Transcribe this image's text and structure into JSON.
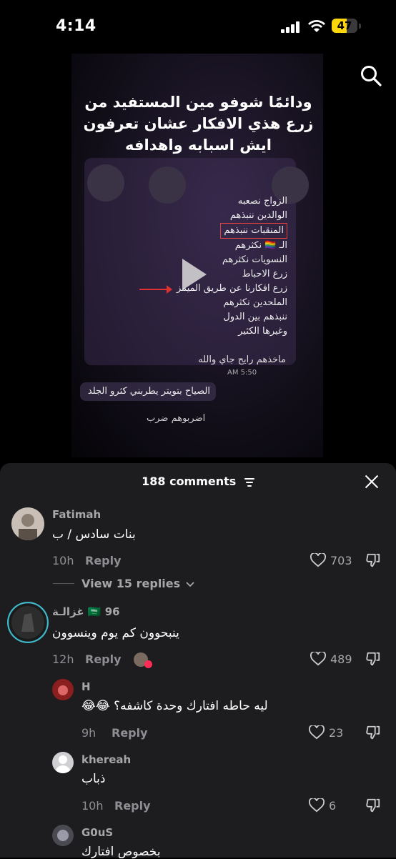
{
  "status_bar": {
    "time": "4:14",
    "battery": "47"
  },
  "video": {
    "overlay_title": "ودائمًا شوفو مين المستفيد من زرع هذي الافكار عشان تعرفون ايش اسبابه واهدافه",
    "list_items": [
      "الزواج نصعبه",
      "الوالدين ننبذهم",
      "المنقبات ننبذهم",
      "الـ 🏳️‍🌈 نكثرهم",
      "النسويات نكثرهم",
      "زرع الاحباط",
      "زرع افكارنا عن طريق الميمز",
      "الملحدين نكثرهم",
      "ننبذهم بين الدول",
      "وغيرها الكثير"
    ],
    "footer_line": "ماخذهم رايح جاي والله",
    "message_time": "AM 5:50",
    "chat1": "الصياح بتويتر يطربني كثرو الجلد",
    "chat2": "اضربوهم ضرب"
  },
  "sheet": {
    "count_label": "188 comments"
  },
  "comments": [
    {
      "username": "Fatimah",
      "text": "بنات سادس / ب",
      "time": "10h",
      "reply": "Reply",
      "likes": "703",
      "view_replies": "View 15 replies"
    },
    {
      "username": "غزالـة 🇸🇦 96",
      "text": "ينبحوون كم يوم وينسوون",
      "time": "12h",
      "reply": "Reply",
      "likes": "489"
    },
    {
      "username": "H",
      "text": "ليه حاطه افتارك وحدة كاشفه؟ 😂😂",
      "time": "9h",
      "reply": "Reply",
      "likes": "23"
    },
    {
      "username": "khereah",
      "text": "ذباب",
      "time": "10h",
      "reply": "Reply",
      "likes": "6"
    },
    {
      "username": "G0uS",
      "text": "بخصوص افتارك"
    }
  ],
  "icons": {
    "search": "search-icon",
    "close": "close-icon",
    "filter": "filter-icon",
    "heart": "heart-icon",
    "dislike": "dislike-icon",
    "chevron": "chevron-down-icon"
  }
}
